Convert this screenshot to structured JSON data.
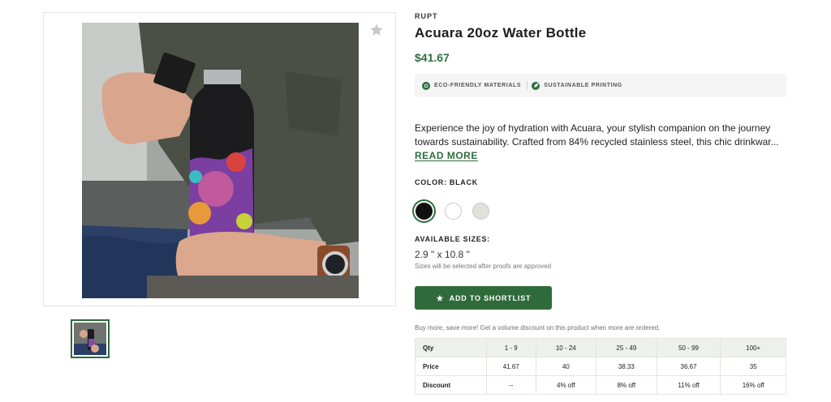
{
  "product": {
    "brand": "RUPT",
    "title": "Acuara 20oz Water Bottle",
    "price": "$41.67",
    "badges": [
      {
        "label": "ECO-FRIENDLY MATERIALS",
        "icon": "eco-icon"
      },
      {
        "label": "SUSTAINABLE PRINTING",
        "icon": "leaf-icon"
      }
    ],
    "description_line1": "Experience the joy of hydration with Acuara, your stylish companion on the journey",
    "description_line2": "towards sustainability. Crafted from 84% recycled stainless steel, this chic drinkwar...",
    "read_more": "READ MORE",
    "color_label": "COLOR: BLACK",
    "colors": [
      {
        "name": "Black",
        "hex": "#111111",
        "selected": true
      },
      {
        "name": "White",
        "hex": "#ffffff",
        "selected": false
      },
      {
        "name": "Gray",
        "hex": "#e1e1dc",
        "selected": false
      }
    ],
    "sizes_label": "AVAILABLE SIZES:",
    "size_value": "2.9 \" x 10.8 \"",
    "size_note": "Sizes will be selected after proofs are approved",
    "shortlist_label": "ADD TO SHORTLIST",
    "volume_note": "Buy more, save more! Get a volume discount on this product when more are ordered."
  },
  "volume_table": {
    "headers": [
      "Qty",
      "1 - 9",
      "10 - 24",
      "25 - 49",
      "50 - 99",
      "100+"
    ],
    "price_row": [
      "Price",
      "41.67",
      "40",
      "38.33",
      "36.67",
      "35"
    ],
    "discount_row": [
      "Discount",
      "--",
      "4% off",
      "8% off",
      "11% off",
      "16% off"
    ]
  },
  "colors": {
    "accent": "#2f6f3e",
    "button": "#2f6a3b",
    "badge_bg": "#f4f5f4"
  }
}
